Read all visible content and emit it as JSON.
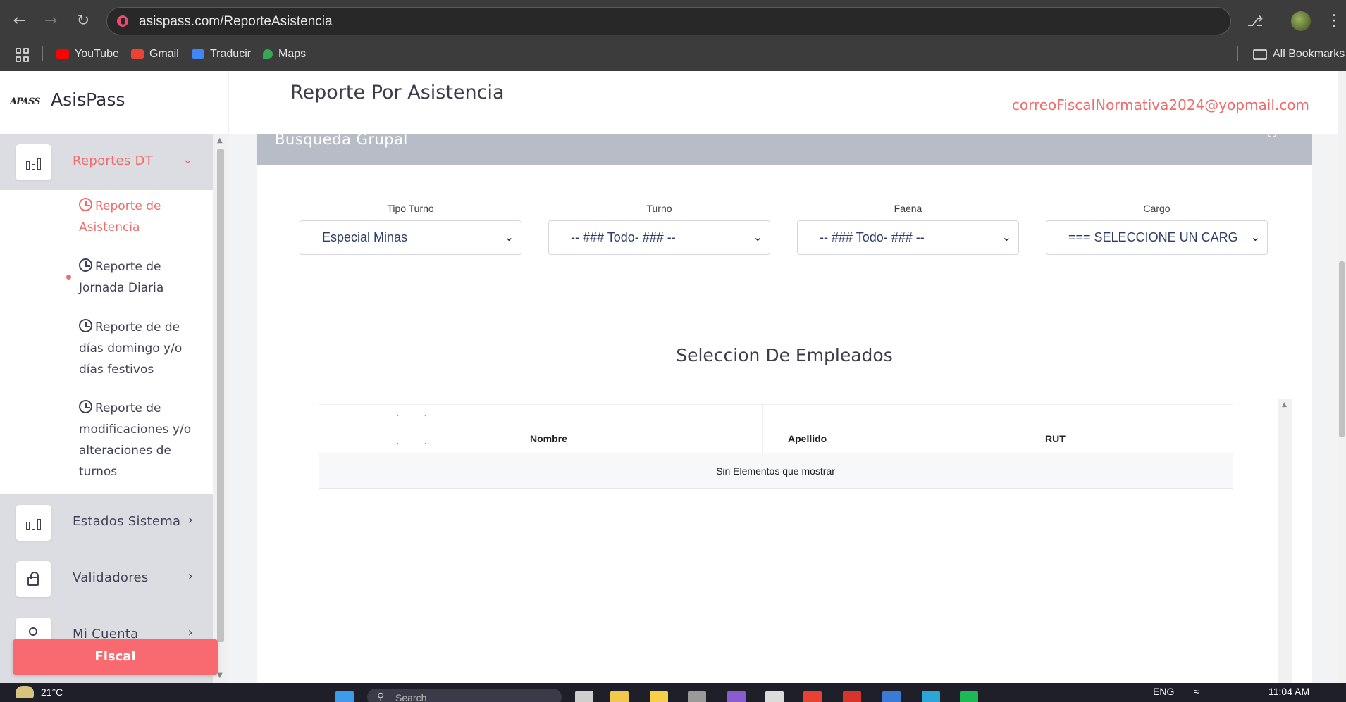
{
  "browser": {
    "url": "asispass.com/ReporteAsistencia",
    "bookmarks": [
      "YouTube",
      "Gmail",
      "Traducir",
      "Maps"
    ],
    "all_bookmarks_label": "All Bookmarks",
    "colors": {
      "youtube": "#ff0000",
      "gmail": "#ea4335",
      "translate": "#4285f4",
      "maps": "#34a853"
    }
  },
  "app": {
    "brand_logo_text": "APASS",
    "brand_name": "AsisPass",
    "page_title": "Reporte Por Asistencia",
    "user_email": "correoFiscalNormativa2024@yopmail.com",
    "accent_color": "#f06b6b"
  },
  "sidebar": {
    "groups": [
      {
        "label": "Reportes DT",
        "icon": "bar-chart-icon",
        "expanded": true
      },
      {
        "label": "Estados Sistema",
        "icon": "bar-chart-icon"
      },
      {
        "label": "Validadores",
        "icon": "lock-icon"
      },
      {
        "label": "Mi Cuenta",
        "icon": "user-icon"
      }
    ],
    "submenu": [
      {
        "label": "Reporte de Asistencia",
        "active": true
      },
      {
        "label": "Reporte de Jornada Diaria"
      },
      {
        "label": "Reporte de de días domingo y/o días festivos"
      },
      {
        "label": "Reporte de modificaciones y/o alteraciones de turnos"
      }
    ],
    "footer_button": "Fiscal"
  },
  "main": {
    "card_title": "Busqueda Grupal",
    "filters": [
      {
        "label": "Tipo Turno",
        "value": "Especial Minas"
      },
      {
        "label": "Turno",
        "value": "-- ### Todo- ### --"
      },
      {
        "label": "Faena",
        "value": "-- ### Todo- ### --"
      },
      {
        "label": "Cargo",
        "value": "=== SELECCIONE UN CARG"
      }
    ],
    "section_title": "Seleccion De Empleados",
    "table": {
      "columns": [
        "Nombre",
        "Apellido",
        "RUT"
      ],
      "empty_message": "Sin Elementos que mostrar"
    }
  },
  "taskbar": {
    "temperature": "21°C",
    "search_placeholder": "Search",
    "language": "ENG",
    "time": "11:04 AM"
  }
}
